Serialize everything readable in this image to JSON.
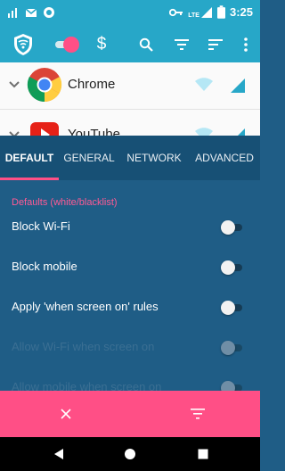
{
  "status_bar": {
    "time": "3:25",
    "lte_label": "LTE",
    "icons": [
      "signal-bars-icon",
      "gmail-icon",
      "circle-app-icon",
      "key-icon",
      "lte-icon",
      "battery-icon"
    ]
  },
  "toolbar": {
    "icons": [
      "shield-logo-icon",
      "toggle-icon",
      "dollar-icon",
      "search-icon",
      "filter-icon",
      "sort-icon",
      "more-vert-icon"
    ],
    "accent": "#27a7c8"
  },
  "app_list": {
    "rows": [
      {
        "name": "Chrome",
        "icon": "chrome-icon"
      },
      {
        "name": "YouTube",
        "icon": "youtube-icon"
      }
    ]
  },
  "tabs": {
    "items": [
      "DEFAULT",
      "GENERAL",
      "NETWORK",
      "ADVANCED"
    ],
    "selected": "DEFAULT",
    "indicator_color": "#ff4f86"
  },
  "settings": {
    "section_title": "Defaults (white/blacklist)",
    "rows": [
      {
        "label": "Block Wi-Fi",
        "on": false,
        "enabled": true
      },
      {
        "label": "Block mobile",
        "on": false,
        "enabled": true
      },
      {
        "label": "Apply 'when screen on' rules",
        "on": false,
        "enabled": true
      },
      {
        "label": "Allow Wi-Fi when screen on",
        "on": false,
        "enabled": false
      },
      {
        "label": "Allow mobile when screen on",
        "on": false,
        "enabled": false
      }
    ]
  },
  "action_bar": {
    "icons": [
      "close-icon",
      "filter-icon"
    ],
    "color": "#ff4f86"
  },
  "nav_bar": {
    "icons": [
      "back-triangle-icon",
      "home-circle-icon",
      "recents-square-icon"
    ]
  }
}
